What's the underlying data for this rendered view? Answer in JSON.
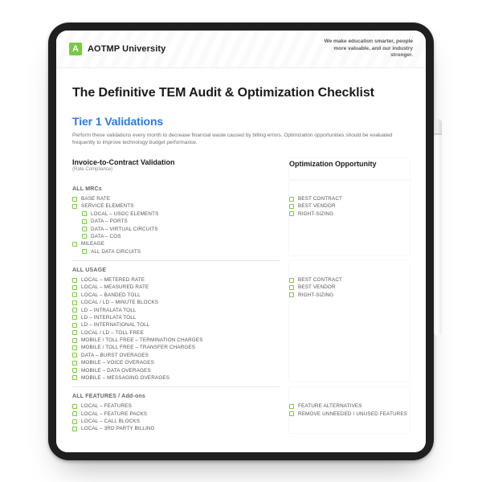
{
  "brand": {
    "logo_letter": "A",
    "name": "AOTMP University",
    "tagline": "We make education smarter, people more valuable, and our industry stronger."
  },
  "document": {
    "title": "The Definitive TEM Audit & Optimization Checklist",
    "tier_label": "Tier 1 Validations",
    "tier_desc": "Perform these validations every month to decrease financial waste caused by billing errors. Optimization opportunities should be evaluated frequently to improve technology budget performance.",
    "left_heading": "Invoice-to-Contract Validation",
    "left_subheading": "(Rate Compliance)",
    "right_heading": "Optimization Opportunity"
  },
  "sections": [
    {
      "group_label": "ALL MRCs",
      "left_items": [
        {
          "label": "BASE RATE",
          "indent": 0
        },
        {
          "label": "SERVICE ELEMENTS",
          "indent": 0
        },
        {
          "label": "LOCAL – USOC ELEMENTS",
          "indent": 1
        },
        {
          "label": "DATA – PORTS",
          "indent": 1
        },
        {
          "label": "DATA – VIRTUAL CIRCUITS",
          "indent": 1
        },
        {
          "label": "DATA – COS",
          "indent": 1
        },
        {
          "label": "MILEAGE",
          "indent": 0
        },
        {
          "label": "ALL DATA CIRCUITS",
          "indent": 1
        }
      ],
      "right_items": [
        {
          "label": "BEST CONTRACT"
        },
        {
          "label": "BEST VENDOR"
        },
        {
          "label": "RIGHT-SIZING"
        }
      ]
    },
    {
      "group_label": "ALL USAGE",
      "left_items": [
        {
          "label": "LOCAL – METERED RATE",
          "indent": 0
        },
        {
          "label": "LOCAL – MEASURED RATE",
          "indent": 0
        },
        {
          "label": "LOCAL – BANDED TOLL",
          "indent": 0
        },
        {
          "label": "LOCAL / LD – MINUTE BLOCKS",
          "indent": 0
        },
        {
          "label": "LD – INTRALATA TOLL",
          "indent": 0
        },
        {
          "label": "LD – INTERLATA TOLL",
          "indent": 0
        },
        {
          "label": "LD – INTERNATIONAL TOLL",
          "indent": 0
        },
        {
          "label": "LOCAL / LD – TOLL FREE",
          "indent": 0
        },
        {
          "label": "MOBILE / TOLL FREE – TERMINATION CHARGES",
          "indent": 0
        },
        {
          "label": "MOBILE / TOLL FREE – TRANSFER CHARGES",
          "indent": 0
        },
        {
          "label": "DATA – BURST OVERAGES",
          "indent": 0
        },
        {
          "label": "MOBILE – VOICE OVERAGES",
          "indent": 0
        },
        {
          "label": "MOBILE – DATA OVERAGES",
          "indent": 0
        },
        {
          "label": "MOBILE – MESSAGING OVERAGES",
          "indent": 0
        }
      ],
      "right_items": [
        {
          "label": "BEST CONTRACT"
        },
        {
          "label": "BEST VENDOR"
        },
        {
          "label": "RIGHT-SIZING"
        }
      ]
    },
    {
      "group_label": "ALL FEATURES / Add-ons",
      "left_items": [
        {
          "label": "LOCAL – FEATURES",
          "indent": 0
        },
        {
          "label": "LOCAL – FEATURE PACKS",
          "indent": 0
        },
        {
          "label": "LOCAL – CALL BLOCKS",
          "indent": 0
        },
        {
          "label": "LOCAL – 3RD PARTY BILLING",
          "indent": 0
        }
      ],
      "right_items": [
        {
          "label": "FEATURE ALTERNATIVES"
        },
        {
          "label": "REMOVE UNNEEDED / UNUSED FEATURES"
        }
      ]
    }
  ]
}
